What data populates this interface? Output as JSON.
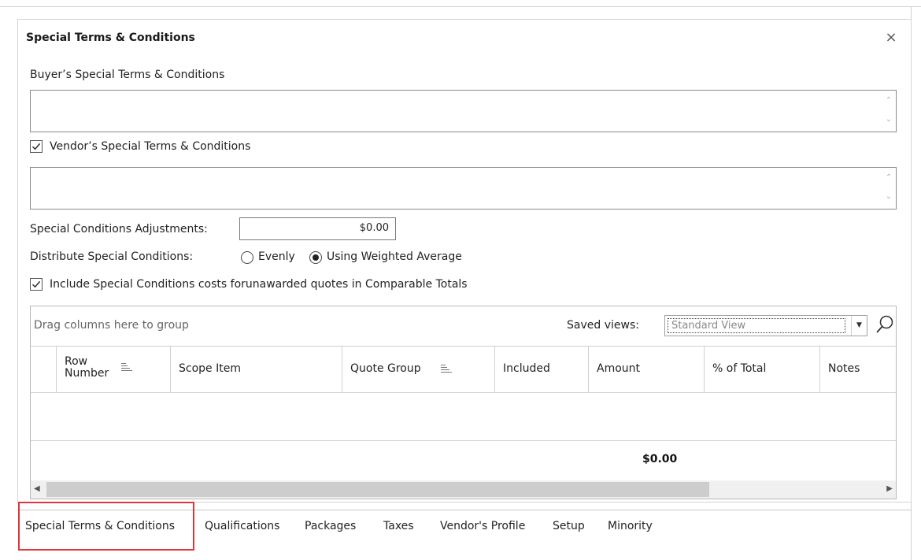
{
  "dialog": {
    "title": "Special Terms & Conditions",
    "close_glyph": "×"
  },
  "buyer": {
    "label": "Buyer’s Special Terms & Conditions",
    "value": ""
  },
  "vendor": {
    "label": "Vendor’s Special Terms & Conditions",
    "checked": true,
    "value": ""
  },
  "adjustments": {
    "label": "Special Conditions Adjustments:",
    "value": "$0.00"
  },
  "distribute": {
    "label": "Distribute Special Conditions:",
    "options": [
      {
        "label": "Evenly",
        "selected": false
      },
      {
        "label": "Using Weighted Average",
        "selected": true
      }
    ]
  },
  "include": {
    "label": "Include Special Conditions costs forunawarded quotes in Comparable Totals",
    "checked": true
  },
  "grid": {
    "drag_hint": "Drag columns here to group",
    "saved_views_label": "Saved views:",
    "saved_view_value": "Standard View",
    "columns": [
      {
        "label": "Row Number",
        "label_line1": "Row",
        "label_line2": "Number",
        "sortable": true
      },
      {
        "label": "Scope Item",
        "sortable": false
      },
      {
        "label": "Quote Group",
        "sortable": true
      },
      {
        "label": "Included",
        "sortable": false
      },
      {
        "label": "Amount",
        "sortable": false
      },
      {
        "label": "% of Total",
        "sortable": false
      },
      {
        "label": "Notes",
        "sortable": false
      }
    ],
    "rows": [],
    "total_amount": "$0.00"
  },
  "tabs": [
    {
      "label": "Special Terms & Conditions",
      "active": true
    },
    {
      "label": "Qualifications",
      "active": false
    },
    {
      "label": "Packages",
      "active": false
    },
    {
      "label": "Taxes",
      "active": false
    },
    {
      "label": "Vendor's Profile",
      "active": false
    },
    {
      "label": "Setup",
      "active": false
    },
    {
      "label": "Minority",
      "active": false
    }
  ],
  "colors": {
    "active_tab_highlight": "#e0353a",
    "border": "#8a8a8a",
    "scrollbar_thumb": "#cdcdcd"
  }
}
